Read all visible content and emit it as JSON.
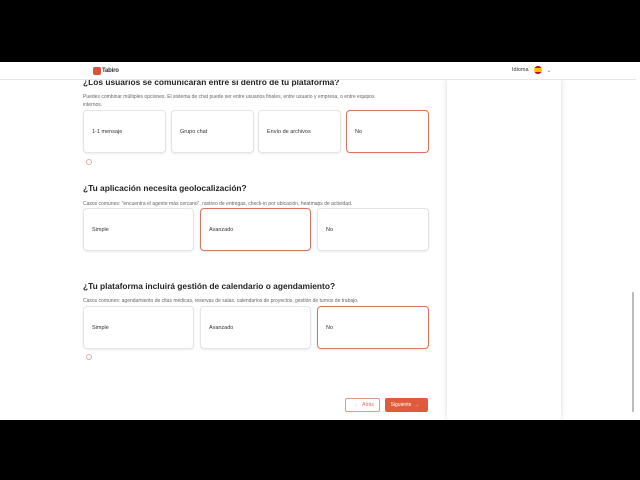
{
  "header": {
    "logo_text": "Tabiro",
    "language_label": "Idioma",
    "language_flag_icon": "spain-flag-icon",
    "dropdown_icon": "chevron-down-icon"
  },
  "questions": [
    {
      "title": "¿Los usuarios se comunicarán entre sí dentro de tu plataforma?",
      "description_line1": "Puedes combinar múltiples opciones. El sistema de chat puede ser entre usuarios finales, entre usuario y empresa, o entre equipos",
      "description_line2": "internos.",
      "options": [
        "1-1 mensaje",
        "Grupo chat",
        "Envío de archivos",
        "No"
      ],
      "selected": "No"
    },
    {
      "title": "¿Tu aplicación necesita geolocalización?",
      "description_line1": "Casos comunes: \"encuentra el agente más cercano\", rastreo de entregas, check-in por ubicación, heatmaps de actividad.",
      "options": [
        "Simple",
        "Avanzado",
        "No"
      ],
      "selected": "Avanzado"
    },
    {
      "title": "¿Tu plataforma incluirá gestión de calendario o agendamiento?",
      "description_line1": "Casos comunes: agendamiento de citas médicas, reservas de salas, calendarios de proyectos, gestión de turnos de trabajo.",
      "options": [
        "Simple",
        "Avanzado",
        "No"
      ],
      "selected": "No"
    }
  ],
  "navigation": {
    "back_label": "Atrás",
    "back_icon": "arrow-left-icon",
    "next_label": "Siguiente",
    "next_icon": "arrow-right-icon"
  },
  "colors": {
    "accent": "#e05a3c",
    "selected_border": "#d9745e"
  }
}
